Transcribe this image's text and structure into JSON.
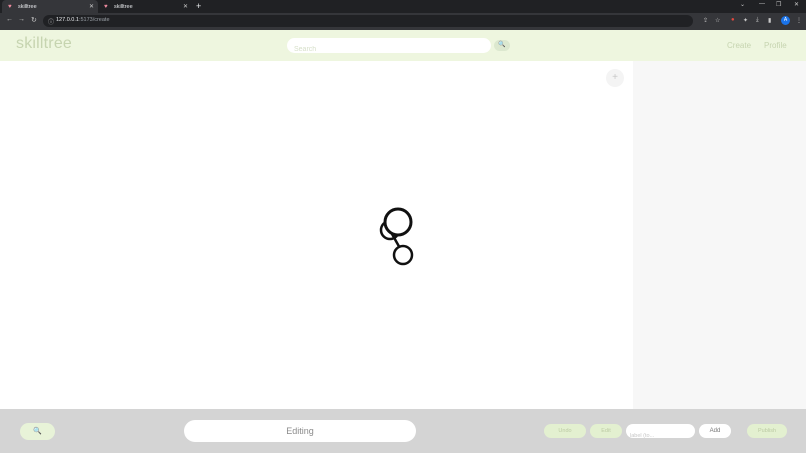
{
  "browser": {
    "tabs": [
      {
        "title": "skilltree",
        "active": true
      },
      {
        "title": "skilltree",
        "active": false
      }
    ],
    "url_host": "127.0.0.1",
    "url_path": ":5173/create",
    "profile_initial": "A"
  },
  "header": {
    "logo": "skilltree",
    "search_placeholder": "Search",
    "nav": {
      "create": "Create",
      "profile": "Profile"
    }
  },
  "canvas": {
    "add_node_label": "+"
  },
  "bottom_bar": {
    "mode_label": "Editing",
    "actions": {
      "undo": "Undo",
      "edit": "Edit",
      "add": "Add",
      "publish": "Publish"
    },
    "label_placeholder": "label (to..."
  },
  "colors": {
    "header_bg": "#eef6df",
    "accent_text": "#c6d4b0",
    "bottom_bar_bg": "#d4d4d4",
    "side_panel_bg": "#f7f7f7"
  }
}
